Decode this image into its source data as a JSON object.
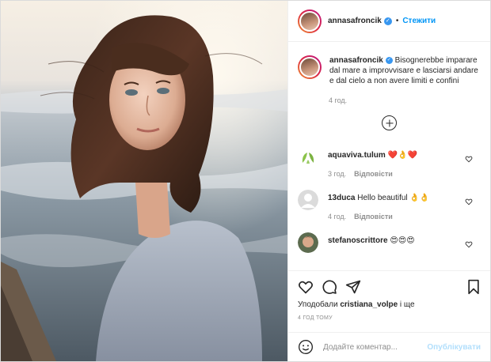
{
  "header": {
    "username": "annasafroncik",
    "separator": "•",
    "follow_label": "Стежити"
  },
  "caption": {
    "username": "annasafroncik",
    "text": "Bisognerebbe imparare dal mare a improvvisare e lasciarsi andare e dal cielo a non avere limiti e confini",
    "time": "4 год."
  },
  "comments": [
    {
      "username": "aquaviva.tulum",
      "text": "❤️👌❤️",
      "time": "3 год.",
      "reply_label": "Відповісти"
    },
    {
      "username": "13duca",
      "text": "Hello beautiful 👌👌",
      "time": "4 год.",
      "reply_label": "Відповісти"
    },
    {
      "username": "stefanoscrittore",
      "text": "😍😍😍",
      "time": "",
      "reply_label": ""
    }
  ],
  "likes": {
    "prefix": "Уподобали",
    "user": "cristiana_volpe",
    "suffix": "і ще"
  },
  "posted_time": "4 ГОД ТОМУ",
  "add_comment": {
    "placeholder": "Додайте коментар...",
    "publish_label": "Опублікувати"
  },
  "colors": {
    "accent": "#0095f6",
    "publish_disabled": "#b2dffc",
    "muted": "#8e8e8e",
    "heart": "#c8102e"
  },
  "icons": [
    "check-verified-icon",
    "plus-circle-icon",
    "heart-icon",
    "comment-icon",
    "share-icon",
    "bookmark-icon",
    "emoji-icon"
  ]
}
